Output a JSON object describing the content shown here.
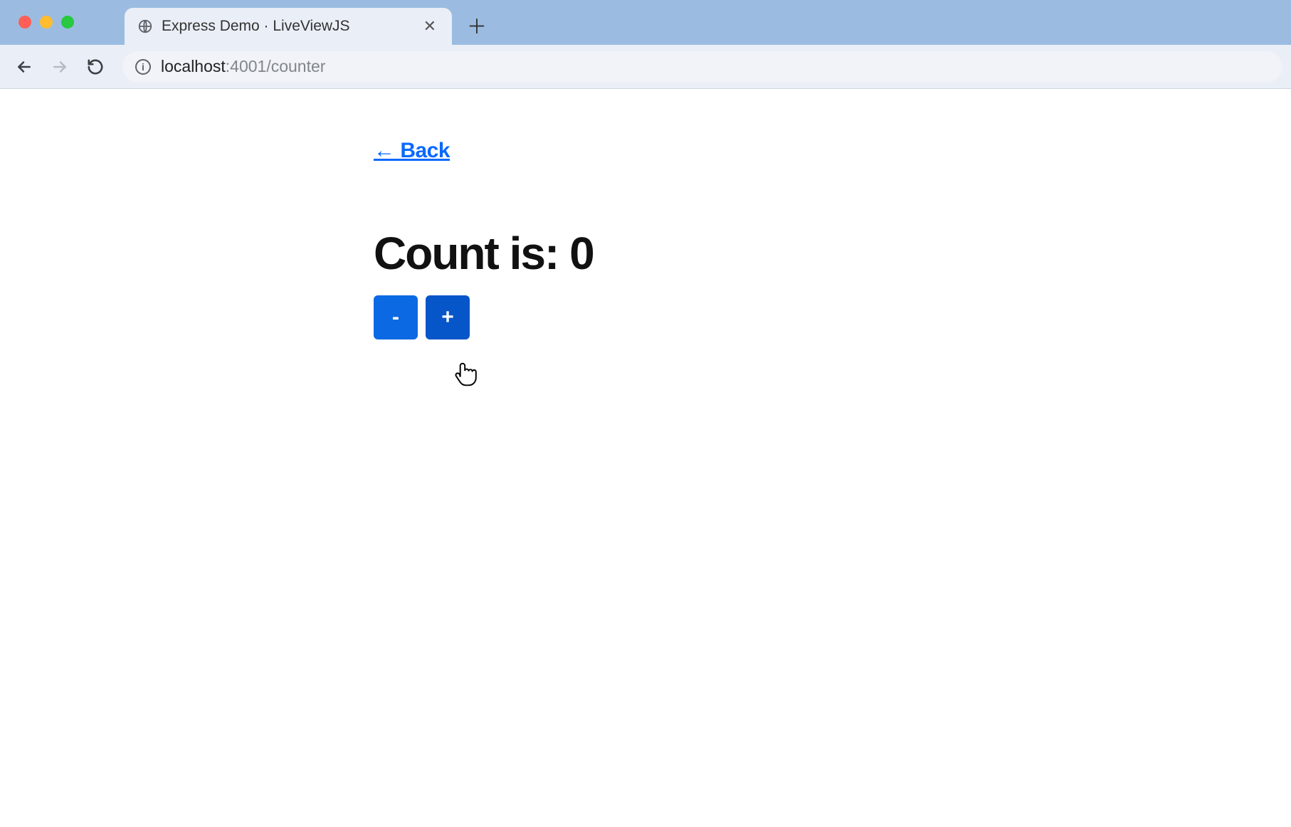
{
  "window": {
    "tab_title": "Express Demo · LiveViewJS"
  },
  "omnibox": {
    "host": "localhost",
    "port_path": ":4001/counter"
  },
  "page": {
    "back_label": "← Back",
    "heading_prefix": "Count is: ",
    "count_value": "0",
    "dec_label": "-",
    "inc_label": "+"
  }
}
